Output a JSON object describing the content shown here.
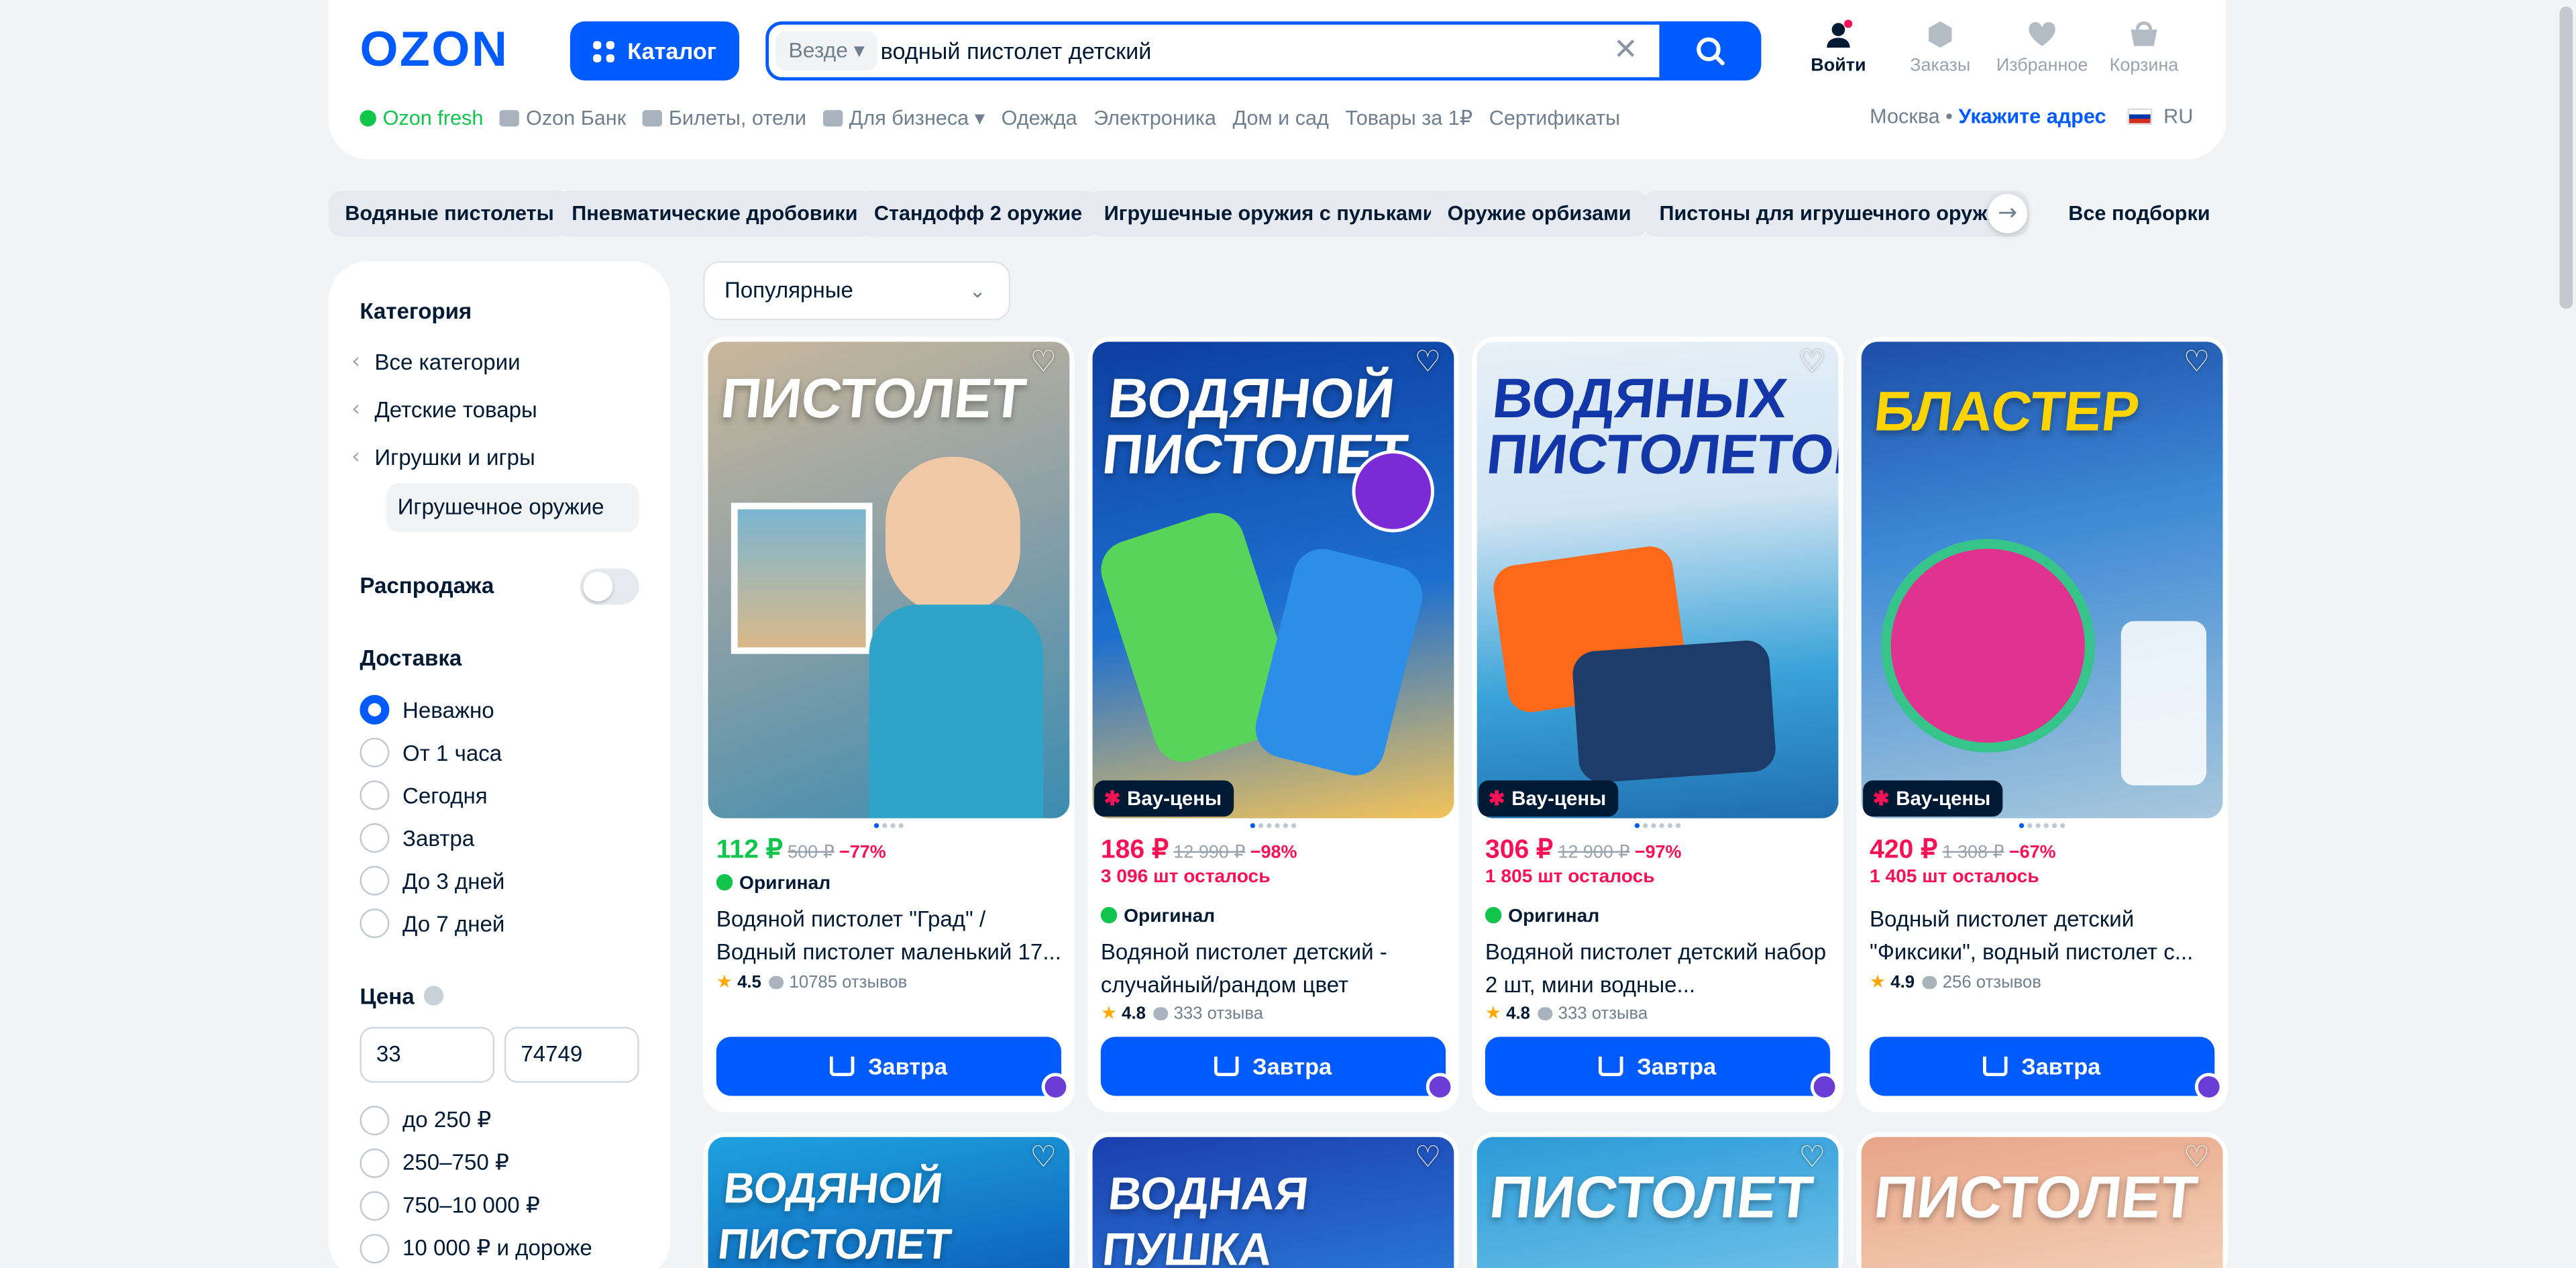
{
  "header": {
    "logo": "OZON",
    "catalog_label": "Каталог",
    "search_scope": "Везде ▾",
    "search_value": "водный пистолет детский",
    "icons": [
      {
        "label": "Войти",
        "icon": "user-icon"
      },
      {
        "label": "Заказы",
        "icon": "box-icon"
      },
      {
        "label": "Избранное",
        "icon": "heart-icon"
      },
      {
        "label": "Корзина",
        "icon": "cart-icon"
      }
    ],
    "nav": [
      "Ozon fresh",
      "Ozon Банк",
      "Билеты, отели",
      "Для бизнеса ▾",
      "Одежда",
      "Электроника",
      "Дом и сад",
      "Товары за 1₽",
      "Сертификаты"
    ],
    "city": "Москва •",
    "address_link": "Укажите адрес",
    "lang": "RU"
  },
  "chips": [
    "Водяные пистолеты",
    "Пневматические дробовики",
    "Стандофф 2 оружие",
    "Игрушечные оружия с пульками",
    "Оружие орбизами",
    "Пистоны для игрушечного оружия"
  ],
  "all_collections": "Все подборки",
  "sidebar": {
    "category_title": "Категория",
    "categories": [
      "Все категории",
      "Детские товары",
      "Игрушки и игры"
    ],
    "current_category": "Игрушечное оружие",
    "sale_label": "Распродажа",
    "delivery_title": "Доставка",
    "delivery_options": [
      "Неважно",
      "От 1 часа",
      "Сегодня",
      "Завтра",
      "До 3 дней",
      "До 7 дней"
    ],
    "delivery_selected": "Неважно",
    "price_title": "Цена",
    "price_from": "33",
    "price_to": "74749",
    "price_ranges": [
      "до 250 ₽",
      "250–750 ₽",
      "750–10 000 ₽",
      "10 000 ₽ и дороже"
    ]
  },
  "sort": {
    "value": "Популярные"
  },
  "products": [
    {
      "img_text": "ПИСТОЛЕТ",
      "wow": "",
      "price": "112 ₽",
      "old": "500 ₽",
      "discount": "−77%",
      "stock": "",
      "original": "Оригинал",
      "title": "Водяной пистолет \"Град\" / Водный пистолет маленький 17...",
      "rating": "4.5",
      "reviews": "10785 отзывов",
      "delivery": "Завтра"
    },
    {
      "img_text": "ВОДЯНОЙ ПИСТОЛЕТ",
      "wow": "Вау-цены",
      "price": "186 ₽",
      "old": "12 990 ₽",
      "discount": "−98%",
      "stock": "3 096 шт осталось",
      "original": "Оригинал",
      "title": "Водяной пистолет детский - случайный/рандом цвет",
      "rating": "4.8",
      "reviews": "333 отзыва",
      "delivery": "Завтра"
    },
    {
      "img_text": "ВОДЯНЫХ ПИСТОЛЕТОВ",
      "wow": "Вау-цены",
      "price": "306 ₽",
      "old": "12 900 ₽",
      "discount": "−97%",
      "stock": "1 805 шт осталось",
      "original": "Оригинал",
      "title": "Водяной пистолет детский набор 2 шт, мини водные...",
      "rating": "4.8",
      "reviews": "333 отзыва",
      "delivery": "Завтра"
    },
    {
      "img_text": "БЛАСТЕР",
      "wow": "Вау-цены",
      "price": "420 ₽",
      "old": "1 308 ₽",
      "discount": "−67%",
      "stock": "1 405 шт осталось",
      "original": "",
      "title": "Водный пистолет детский \"Фиксики\", водный пистолет с...",
      "rating": "4.9",
      "reviews": "256 отзывов",
      "delivery": "Завтра"
    }
  ],
  "row2_img_texts": [
    "ВОДЯНОЙ ПИСТОЛЕТ",
    "ВОДНАЯ ПУШКА",
    "ПИСТОЛЕТ",
    "ПИСТОЛЕТ"
  ],
  "colors": {
    "accent": "#005bff",
    "sale": "#f91155",
    "green": "#10c44c",
    "bg": "#f2f3f5"
  }
}
